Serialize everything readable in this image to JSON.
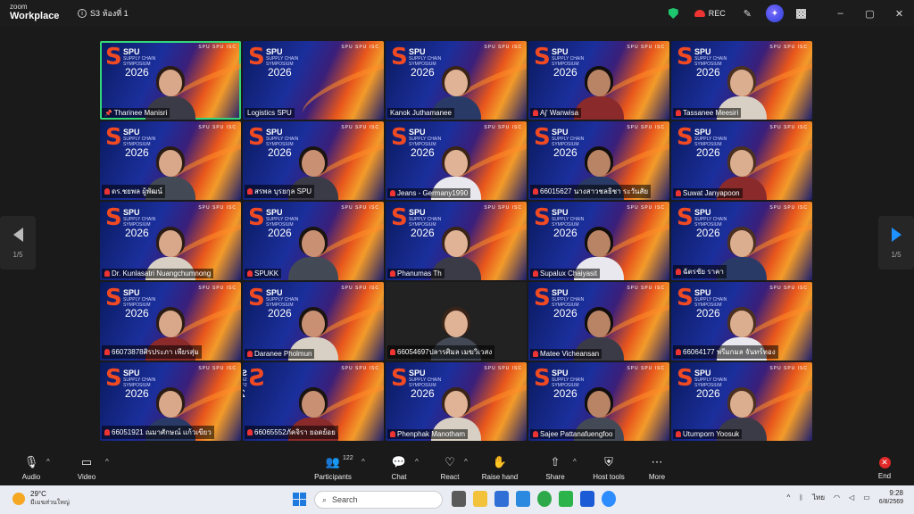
{
  "titlebar": {
    "brand_top": "zoom",
    "brand": "Workplace",
    "meeting_name": "S3 ห้องที่ 1",
    "rec_label": "REC",
    "info_icon": "info-icon",
    "minimize": "–",
    "restore": "▢",
    "close": "✕"
  },
  "tile_bg": {
    "logo_letter": "S",
    "logo_sup": "3",
    "logo_text": "SPU",
    "logo_sub": "SUPPLY CHAIN SYMPOSIUM",
    "logo_year": "2026",
    "sponsors": "SPU SPU ISC"
  },
  "participants": [
    {
      "name": "Tharinee Manisri",
      "muted": false,
      "pinned": true,
      "video": true,
      "active": true
    },
    {
      "name": "Logistics SPU",
      "muted": false,
      "pinned": false,
      "video": false,
      "active": false
    },
    {
      "name": "Kanok Juthamanee",
      "muted": false,
      "pinned": false,
      "video": true,
      "active": false
    },
    {
      "name": "Aj' Wanwisa",
      "muted": true,
      "pinned": false,
      "video": true,
      "active": false
    },
    {
      "name": "Tassanee Meesiri",
      "muted": true,
      "pinned": false,
      "video": true,
      "active": false
    },
    {
      "name": "ดร.ชยพล ผู้พัฒน์",
      "muted": true,
      "pinned": false,
      "video": true,
      "active": false
    },
    {
      "name": "สรพล บุรยกุล SPU",
      "muted": true,
      "pinned": false,
      "video": true,
      "active": false
    },
    {
      "name": "Jeans - Germany1990",
      "muted": true,
      "pinned": false,
      "video": true,
      "active": false
    },
    {
      "name": "66015627 นางสาวชลธิชา ระวันสัย",
      "muted": true,
      "pinned": false,
      "video": true,
      "active": false
    },
    {
      "name": "Suwat Janyapoon",
      "muted": true,
      "pinned": false,
      "video": true,
      "active": false
    },
    {
      "name": "Dr. Kunlasatri Nuangchumnong",
      "muted": true,
      "pinned": false,
      "video": true,
      "active": false
    },
    {
      "name": "SPUKK",
      "muted": true,
      "pinned": false,
      "video": true,
      "active": false
    },
    {
      "name": "Phanumas Th",
      "muted": true,
      "pinned": false,
      "video": true,
      "active": false
    },
    {
      "name": "Supalux Chaiyasit",
      "muted": true,
      "pinned": false,
      "video": true,
      "active": false
    },
    {
      "name": "ฉัตรชัย ราคา",
      "muted": true,
      "pinned": false,
      "video": true,
      "active": false
    },
    {
      "name": "66073878ศิรประภา เพียรสุ่ม",
      "muted": true,
      "pinned": false,
      "video": true,
      "active": false
    },
    {
      "name": "Daranee Pholmun",
      "muted": true,
      "pinned": false,
      "video": true,
      "active": false
    },
    {
      "name": "66054697ปลารศิมล เมฆวิเวสง",
      "muted": true,
      "pinned": false,
      "video": true,
      "active": false,
      "plain": true
    },
    {
      "name": "Matee Vicheansan",
      "muted": true,
      "pinned": false,
      "video": true,
      "active": false
    },
    {
      "name": "66064177 พรีมกมล จันทร์ทอง",
      "muted": true,
      "pinned": false,
      "video": true,
      "active": false
    },
    {
      "name": "66051921 ณมาศักษณ์ แก้วเขียว",
      "muted": true,
      "pinned": false,
      "video": true,
      "active": false
    },
    {
      "name": "66065552ภัคจิรา ยอดย้อย",
      "muted": true,
      "pinned": false,
      "video": true,
      "active": false,
      "mirrored": true
    },
    {
      "name": "Phenphak Manotham",
      "muted": true,
      "pinned": false,
      "video": true,
      "active": false
    },
    {
      "name": "Sajee Pattanafuengfoo",
      "muted": true,
      "pinned": false,
      "video": true,
      "active": false
    },
    {
      "name": "Utumporn Yoosuk",
      "muted": true,
      "pinned": false,
      "video": true,
      "active": false
    }
  ],
  "pager": {
    "left": "1/5",
    "right": "1/5"
  },
  "toolbar": {
    "audio": "Audio",
    "video": "Video",
    "participants": "Participants",
    "participants_count": "122",
    "chat": "Chat",
    "react": "React",
    "raise_hand": "Raise hand",
    "share": "Share",
    "host_tools": "Host tools",
    "more": "More",
    "end": "End"
  },
  "taskbar": {
    "temp": "29°C",
    "weather_desc": "มีเมฆส่วนใหญ่",
    "search_placeholder": "Search",
    "lang": "ไทย",
    "time": "9:28",
    "date": "6/8/2569"
  },
  "colors": {
    "active_border": "#34d67a",
    "end_red": "#e02828",
    "next_arrow": "#1e90ff",
    "shield_green": "#1ec86e"
  }
}
